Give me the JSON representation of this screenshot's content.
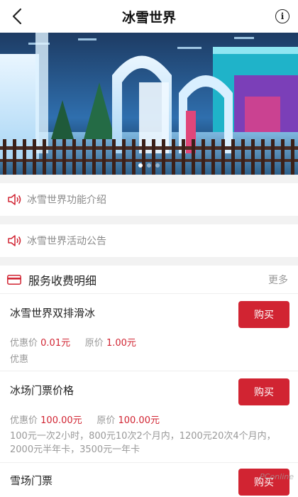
{
  "nav": {
    "title": "冰雪世界",
    "info_glyph": "i"
  },
  "banner": {
    "slides": 3,
    "active": 0
  },
  "notices": [
    {
      "label": "冰雪世界功能介绍"
    },
    {
      "label": "冰雪世界活动公告"
    }
  ],
  "service": {
    "title": "服务收费明细",
    "more": "更多",
    "items": [
      {
        "name": "冰雪世界双排滑冰",
        "buy": "购买",
        "discount_label": "优惠价",
        "discount_price": "0.01元",
        "original_label": "原价",
        "original_price": "1.00元",
        "desc": "优惠"
      },
      {
        "name": "冰场门票价格",
        "buy": "购买",
        "discount_label": "优惠价",
        "discount_price": "100.00元",
        "original_label": "原价",
        "original_price": "100.00元",
        "desc": "100元一次2小时，800元10次2个月内，1200元20次4个月内，2000元半年卡，3500元一年卡"
      },
      {
        "name": "雪场门票",
        "buy": "购买"
      }
    ]
  },
  "watermark": "PConline",
  "colors": {
    "accent": "#d12432"
  }
}
